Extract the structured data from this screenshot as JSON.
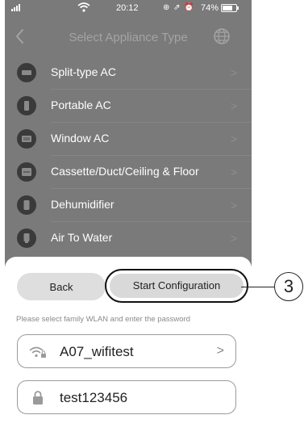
{
  "status_bar": {
    "time": "20:12",
    "status_icons": "⊕ ⇗ ⏰",
    "battery_percent": "74%",
    "battery_level": 0.74
  },
  "nav": {
    "title": "Select Appliance Type",
    "back_icon": "chevron-left-icon",
    "right_icon": "globe-icon"
  },
  "appliances": [
    {
      "label": "Split-type AC",
      "icon": "split-ac-icon"
    },
    {
      "label": "Portable AC",
      "icon": "portable-ac-icon"
    },
    {
      "label": "Window AC",
      "icon": "window-ac-icon"
    },
    {
      "label": "Cassette/Duct/Ceiling & Floor",
      "icon": "cassette-icon"
    },
    {
      "label": "Dehumidifier",
      "icon": "dehumidifier-icon"
    },
    {
      "label": "Air To Water",
      "icon": "air-to-water-icon"
    }
  ],
  "chevron": ">",
  "sheet": {
    "back_label": "Back",
    "start_label": "Start Configuration",
    "hint": "Please select family WLAN and enter the password",
    "wifi_name": "A07_wifitest",
    "password": "test123456"
  },
  "callout": {
    "number": "3"
  },
  "colors": {
    "overlay": "#7a7a7a",
    "icon_bg": "#3a3a3a",
    "button_bg": "#d9d9d9",
    "text": "#222222"
  }
}
